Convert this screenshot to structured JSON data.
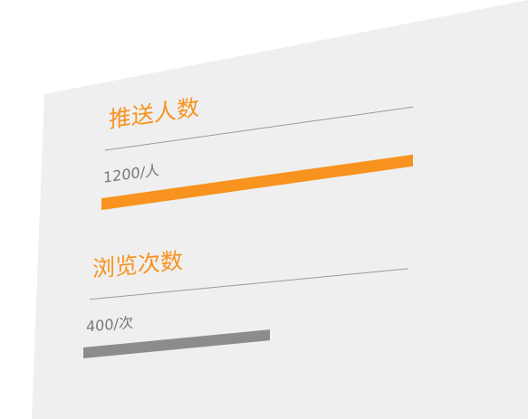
{
  "stats": [
    {
      "title": "推送人数",
      "value": "1200",
      "unit": "人",
      "level": 1.0,
      "color": "#f7931e"
    },
    {
      "title": "浏览次数",
      "value": "400",
      "unit": "次",
      "level": 0.6,
      "color": "#8c8c8c"
    }
  ]
}
